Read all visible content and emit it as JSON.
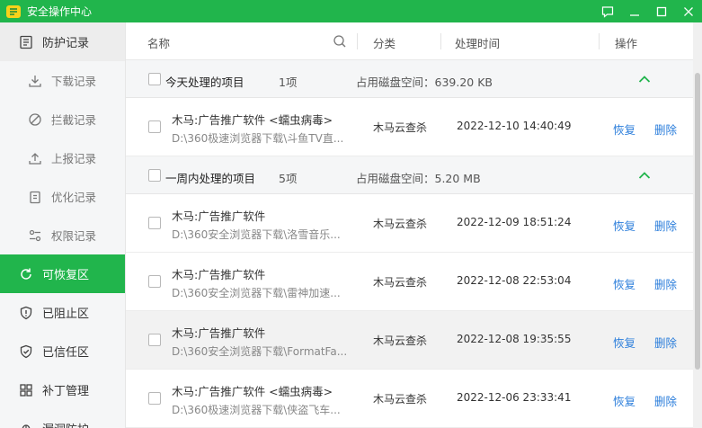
{
  "window": {
    "title": "安全操作中心"
  },
  "sidebar": {
    "items": [
      {
        "label": "防护记录"
      },
      {
        "label": "下载记录"
      },
      {
        "label": "拦截记录"
      },
      {
        "label": "上报记录"
      },
      {
        "label": "优化记录"
      },
      {
        "label": "权限记录"
      },
      {
        "label": "可恢复区"
      },
      {
        "label": "已阻止区"
      },
      {
        "label": "已信任区"
      },
      {
        "label": "补丁管理"
      },
      {
        "label": "漏洞防护"
      }
    ]
  },
  "table": {
    "headers": {
      "name": "名称",
      "category": "分类",
      "time": "处理时间",
      "action": "操作"
    },
    "groups": [
      {
        "title": "今天处理的项目",
        "count": "1项",
        "disk": "占用磁盘空间：639.20 KB"
      },
      {
        "title": "一周内处理的项目",
        "count": "5项",
        "disk": "占用磁盘空间：5.20 MB"
      }
    ],
    "rows": [
      {
        "name": "木马:广告推广软件 <蠕虫病毒>",
        "path": "D:\\360极速浏览器下载\\斗鱼TV直...",
        "category": "木马云查杀",
        "time": "2022-12-10 14:40:49",
        "restore": "恢复",
        "delete": "删除"
      },
      {
        "name": "木马:广告推广软件",
        "path": "D:\\360安全浏览器下载\\洛雪音乐...",
        "category": "木马云查杀",
        "time": "2022-12-09 18:51:24",
        "restore": "恢复",
        "delete": "删除"
      },
      {
        "name": "木马:广告推广软件",
        "path": "D:\\360安全浏览器下载\\雷神加速...",
        "category": "木马云查杀",
        "time": "2022-12-08 22:53:04",
        "restore": "恢复",
        "delete": "删除"
      },
      {
        "name": "木马:广告推广软件",
        "path": "D:\\360安全浏览器下载\\FormatFa...",
        "category": "木马云查杀",
        "time": "2022-12-08 19:35:55",
        "restore": "恢复",
        "delete": "删除"
      },
      {
        "name": "木马:广告推广软件 <蠕虫病毒>",
        "path": "D:\\360极速浏览器下载\\侠盗飞车...",
        "category": "木马云查杀",
        "time": "2022-12-06 23:33:41",
        "restore": "恢复",
        "delete": "删除"
      }
    ]
  },
  "colors": {
    "accent": "#21b54c",
    "link": "#2a7ddb"
  }
}
